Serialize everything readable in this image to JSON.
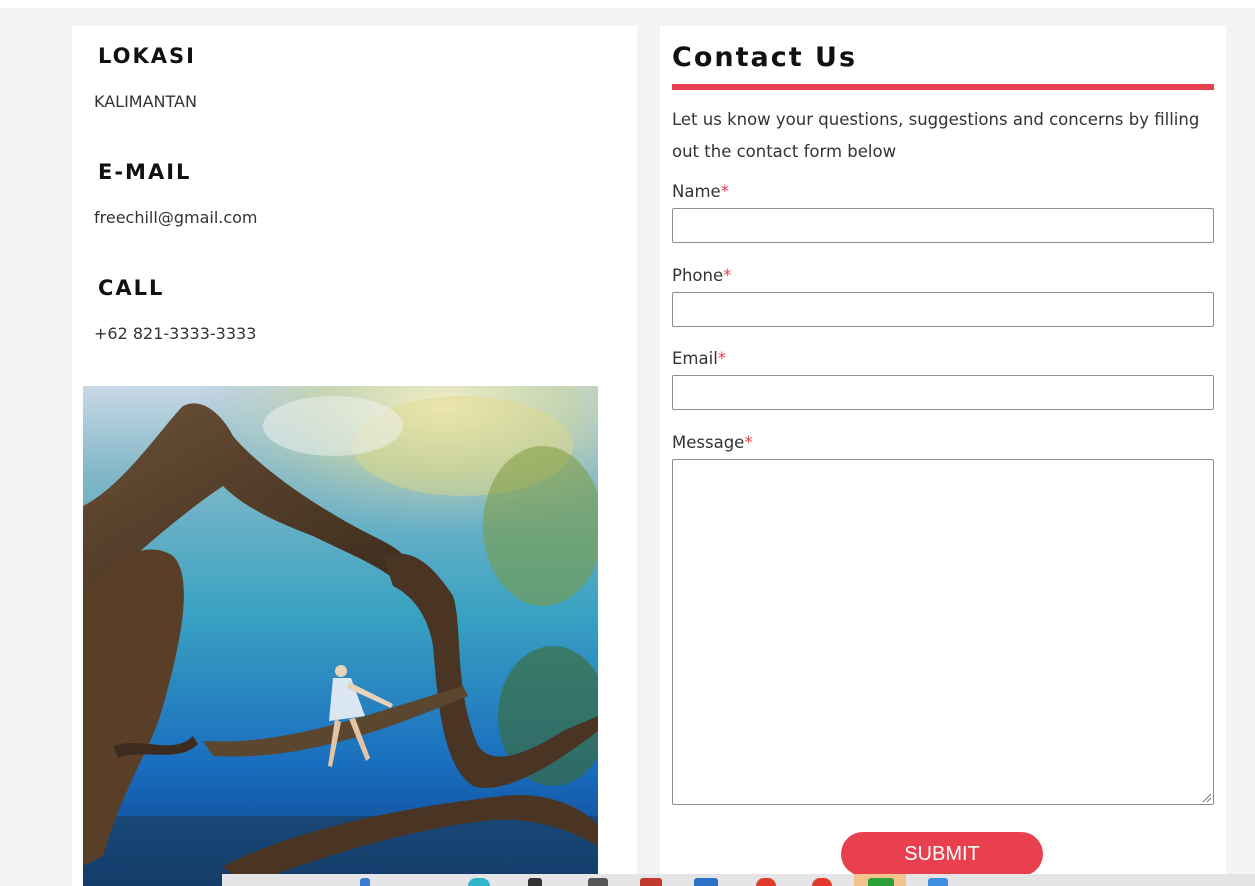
{
  "info": {
    "location_heading": "LOKASI",
    "location_value": "KALIMANTAN",
    "email_heading": "E-MAIL",
    "email_value": "freechill@gmail.com",
    "call_heading": "CALL",
    "call_value": "+62 821-3333-3333"
  },
  "contact": {
    "title": "Contact Us",
    "intro": "Let us know your questions, suggestions and concerns by filling out the contact form below",
    "required_marker": "*",
    "fields": {
      "name_label": "Name",
      "phone_label": "Phone",
      "email_label": "Email",
      "message_label": "Message",
      "name_value": "",
      "phone_value": "",
      "email_value": "",
      "message_value": ""
    },
    "submit_label": "SUBMIT"
  },
  "colors": {
    "accent": "#e8404f",
    "page_background": "#f4f4f4",
    "card_background": "#ffffff"
  },
  "icons": {
    "photo": "underwater-photo",
    "taskbar": [
      "taskbar-app-icon",
      "taskbar-app-icon",
      "taskbar-app-icon",
      "taskbar-app-icon",
      "taskbar-app-icon",
      "taskbar-app-icon",
      "taskbar-app-icon",
      "taskbar-app-icon",
      "taskbar-app-icon",
      "taskbar-app-icon",
      "taskbar-app-icon"
    ]
  }
}
